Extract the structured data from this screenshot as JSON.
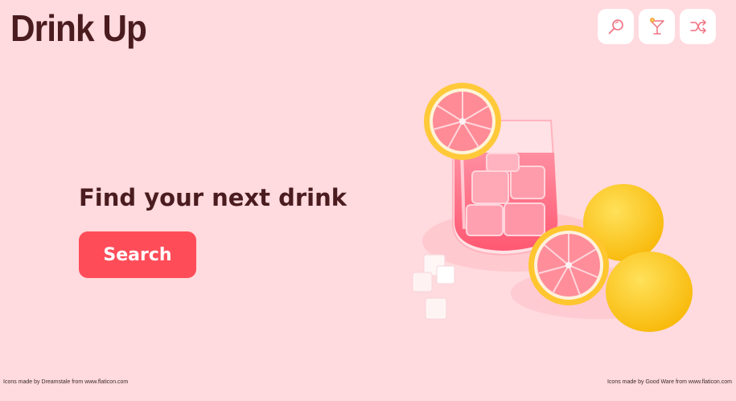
{
  "header": {
    "title": "Drink Up",
    "nav": [
      {
        "name": "search-icon",
        "label": "Search"
      },
      {
        "name": "cocktail-icon",
        "label": "Cocktails"
      },
      {
        "name": "shuffle-icon",
        "label": "Random"
      }
    ]
  },
  "hero": {
    "heading": "Find your next drink",
    "button_label": "Search",
    "image": "pink-drink-with-grapefruit-and-lemons"
  },
  "footer": {
    "credit_left_prefix": "Icons made by",
    "credit_left_author": "Dreamstale",
    "credit_left_mid": "from",
    "credit_left_site": "www.flaticon.com",
    "credit_right_prefix": "Icons made by",
    "credit_right_author": "Good Ware",
    "credit_right_mid": "from",
    "credit_right_site": "www.flaticon.com"
  },
  "colors": {
    "background": "#ffdade",
    "title": "#4a1c1f",
    "button": "#fe4d59",
    "icon_stroke": "#f07080"
  }
}
